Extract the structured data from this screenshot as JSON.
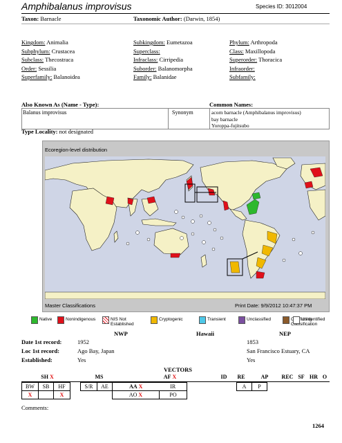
{
  "header": {
    "title": "Amphibalanus improvisus",
    "species_id": "Species ID: 3012004"
  },
  "taxonomy": {
    "taxon_label": "Taxon:",
    "taxon_value": "Barnacle",
    "author_label": "Taxonomic Author:",
    "author_value": "(Darwin, 1854)",
    "rows": [
      [
        {
          "label": "Kingdom:",
          "value": "Animalia"
        },
        {
          "label": "Subkingdom:",
          "value": "Eumetazoa"
        },
        {
          "label": "Phylum:",
          "value": "Arthropoda"
        }
      ],
      [
        {
          "label": "Subphylum:",
          "value": "Crustacea"
        },
        {
          "label": "Superclass:",
          "value": ""
        },
        {
          "label": "Class:",
          "value": "Maxillopoda"
        }
      ],
      [
        {
          "label": "Subclass:",
          "value": "Thecostraca"
        },
        {
          "label": "Infraclass:",
          "value": "Cirripedia"
        },
        {
          "label": "Superorder:",
          "value": "Thoracica"
        }
      ],
      [
        {
          "label": "Order:",
          "value": "Sessilia"
        },
        {
          "label": "Suborder:",
          "value": "Balanomorpha"
        },
        {
          "label": "Infraorder:",
          "value": ""
        }
      ],
      [
        {
          "label": "Superfamily:",
          "value": "Balanoidea"
        },
        {
          "label": "Family:",
          "value": "Balanidae"
        },
        {
          "label": "Subfamily:",
          "value": ""
        }
      ]
    ]
  },
  "aka": {
    "header": "Also Known As (Name - Type):",
    "name": "Balanus improvisus",
    "type": "Synonym",
    "common_header": "Common Names:",
    "common_names": [
      "acorn barnacle (Amphibalanus improvisus)",
      "bay barnacle",
      "Yoroppa-fujitsubo"
    ]
  },
  "type_locality": {
    "label": "Type Locality:",
    "value": "not designated"
  },
  "map": {
    "title": "Ecoregion-level distribution",
    "footer_left": "Master Classifications",
    "footer_right": "Print Date: 9/9/2012 10:47:37 PM",
    "colors": {
      "ocean": "#cfd5e6",
      "land": "#f5f1c6",
      "native": "#2db82d",
      "nonindigenous": "#e0101a",
      "cryptogenic": "#f0b800",
      "transient": "#4ec8e8",
      "unclassified": "#7b4fa0",
      "conflicting": "#8b5a2b"
    }
  },
  "legend": [
    {
      "label": "Native",
      "color": "#2db82d"
    },
    {
      "label": "Nonindigenous",
      "color": "#e0101a"
    },
    {
      "label": "NIS Not Established",
      "color": "#ffffff"
    },
    {
      "label": "Cryptogenic",
      "color": "#f0b800"
    },
    {
      "label": "Transient",
      "color": "#4ec8e8"
    },
    {
      "label": "Unclassified",
      "color": "#7b4fa0"
    },
    {
      "label": "Conflicting Classification",
      "color": "#8b5a2b"
    },
    {
      "label": "Unidentified",
      "color": "#ffffff"
    }
  ],
  "records": {
    "col_nwp": "NWP",
    "col_hawaii": "Hawaii",
    "col_nep": "NEP",
    "date_label": "Date 1st record:",
    "date_nwp": "1952",
    "date_nep": "1853",
    "loc_label": "Loc 1st record:",
    "loc_nwp": "Ago Bay, Japan",
    "loc_nep": "San Francisco Estuary, CA",
    "est_label": "Established:",
    "est_nwp": "Yes",
    "est_nep": "Yes"
  },
  "vectors": {
    "title": "VECTORS",
    "sh": "SH",
    "ms": "MS",
    "af": "AF",
    "id": "ID",
    "re": "RE",
    "ap": "AP",
    "rec": "REC",
    "sf": "SF",
    "hr": "HR",
    "o": "O",
    "x": "X",
    "bw": "BW",
    "sb": "SB",
    "hf": "HF",
    "sr": "S/R",
    "ae": "AE",
    "aa": "AA",
    "ir": "IR",
    "a": "A",
    "p": "P",
    "ao": "AO",
    "po": "PO"
  },
  "comments_label": "Comments:",
  "page_number": "1264"
}
